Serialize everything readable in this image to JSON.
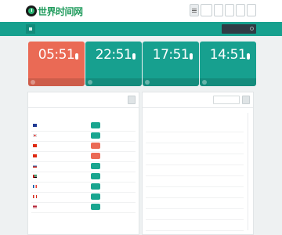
{
  "header": {
    "logo_text": "世界时间网",
    "toolbar": [
      "",
      "",
      "",
      "",
      "",
      ""
    ]
  },
  "nav": {
    "items": [
      "",
      "",
      "",
      "",
      ""
    ],
    "search_placeholder": ""
  },
  "cards": [
    {
      "time": "05:51",
      "badge": "",
      "date": "",
      "footer": "",
      "color": "#ea6a55"
    },
    {
      "time": "22:51",
      "badge": "",
      "date": "",
      "footer": "",
      "color": "#17a08f"
    },
    {
      "time": "17:51",
      "badge": "",
      "date": "",
      "footer": "",
      "color": "#17a08f"
    },
    {
      "time": "14:51",
      "badge": "",
      "date": "",
      "footer": "",
      "color": "#17a08f"
    }
  ],
  "left_panel": {
    "title": "",
    "columns": [
      "",
      "",
      "",
      ""
    ],
    "rows": [
      {
        "flag": "au",
        "country": "",
        "date": "",
        "status": "",
        "status_color": "#19a58f",
        "extra": ""
      },
      {
        "flag": "jp",
        "country": "",
        "date": "",
        "status": "",
        "status_color": "#19a58f",
        "extra": ""
      },
      {
        "flag": "cn",
        "country": "",
        "date": "",
        "status": "",
        "status_color": "#ea6a55",
        "extra": ""
      },
      {
        "flag": "cn",
        "country": "",
        "date": "",
        "status": "",
        "status_color": "#ea6a55",
        "extra": ""
      },
      {
        "flag": "ru",
        "country": "",
        "date": "",
        "status": "",
        "status_color": "#19a58f",
        "extra": ""
      },
      {
        "flag": "ae",
        "country": "",
        "date": "",
        "status": "",
        "status_color": "#19a58f",
        "extra": ""
      },
      {
        "flag": "fr",
        "country": "",
        "date": "",
        "status": "",
        "status_color": "#19a58f",
        "extra": ""
      },
      {
        "flag": "ca",
        "country": "",
        "date": "",
        "status": "",
        "status_color": "#19a58f",
        "extra": ""
      },
      {
        "flag": "us",
        "country": "",
        "date": "",
        "status": "",
        "status_color": "#19a58f",
        "extra": ""
      }
    ]
  },
  "right_panel": {
    "title": "",
    "search_placeholder": "",
    "columns": [
      "",
      "",
      ""
    ],
    "rows": [
      {
        "city": "",
        "offset": "",
        "note": ""
      },
      {
        "city": "",
        "offset": "",
        "note": ""
      },
      {
        "city": "",
        "offset": "",
        "note": ""
      },
      {
        "city": "",
        "offset": "",
        "note": ""
      },
      {
        "city": "",
        "offset": "",
        "note": ""
      },
      {
        "city": "",
        "offset": "",
        "note": ""
      },
      {
        "city": "",
        "offset": "",
        "note": ""
      },
      {
        "city": "",
        "offset": "",
        "note": ""
      },
      {
        "city": "",
        "offset": "",
        "note": ""
      },
      {
        "city": "",
        "offset": "",
        "note": ""
      }
    ]
  }
}
